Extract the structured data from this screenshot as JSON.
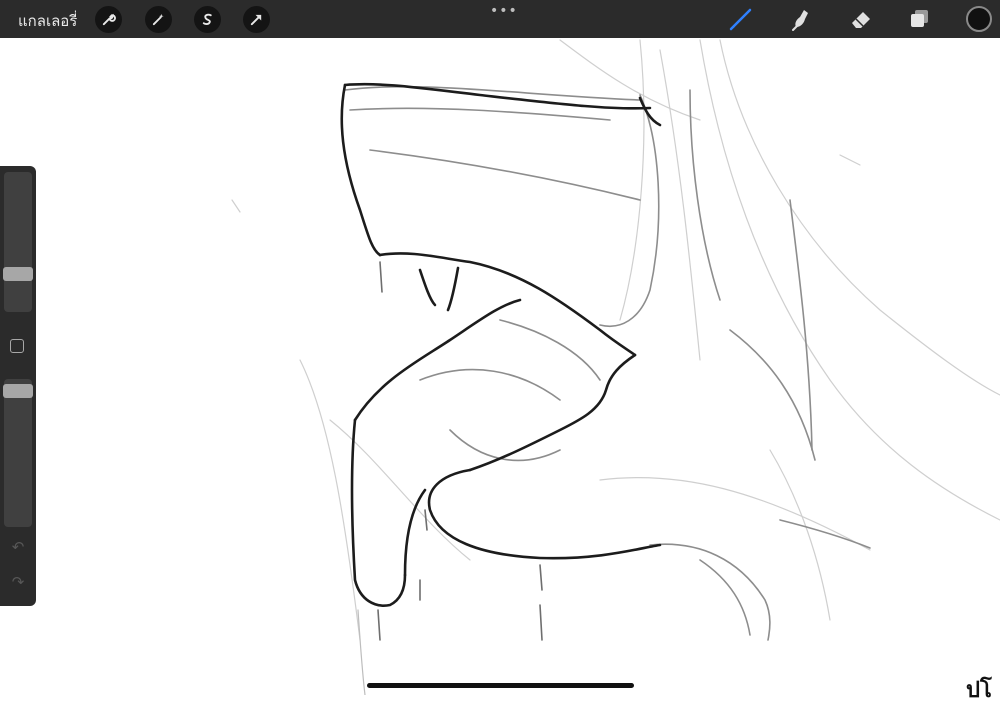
{
  "topbar": {
    "gallery_label": "แกลเลอรี่",
    "more_dots": "•••",
    "left_tools": [
      "wrench-icon",
      "magic-wand-icon",
      "selection-s-icon",
      "transform-arrow-icon"
    ],
    "right_tools": [
      "brush-icon",
      "smudge-icon",
      "eraser-icon",
      "layers-icon"
    ],
    "active_tool": "brush-icon",
    "accent_color": "#2f80ff",
    "current_color": "#111111"
  },
  "sidebar": {
    "brush_size_level": 0.4,
    "opacity_level": 0.95,
    "undo_glyph": "↶",
    "redo_glyph": "↷"
  },
  "canvas": {
    "edge_text": "ปโ"
  }
}
